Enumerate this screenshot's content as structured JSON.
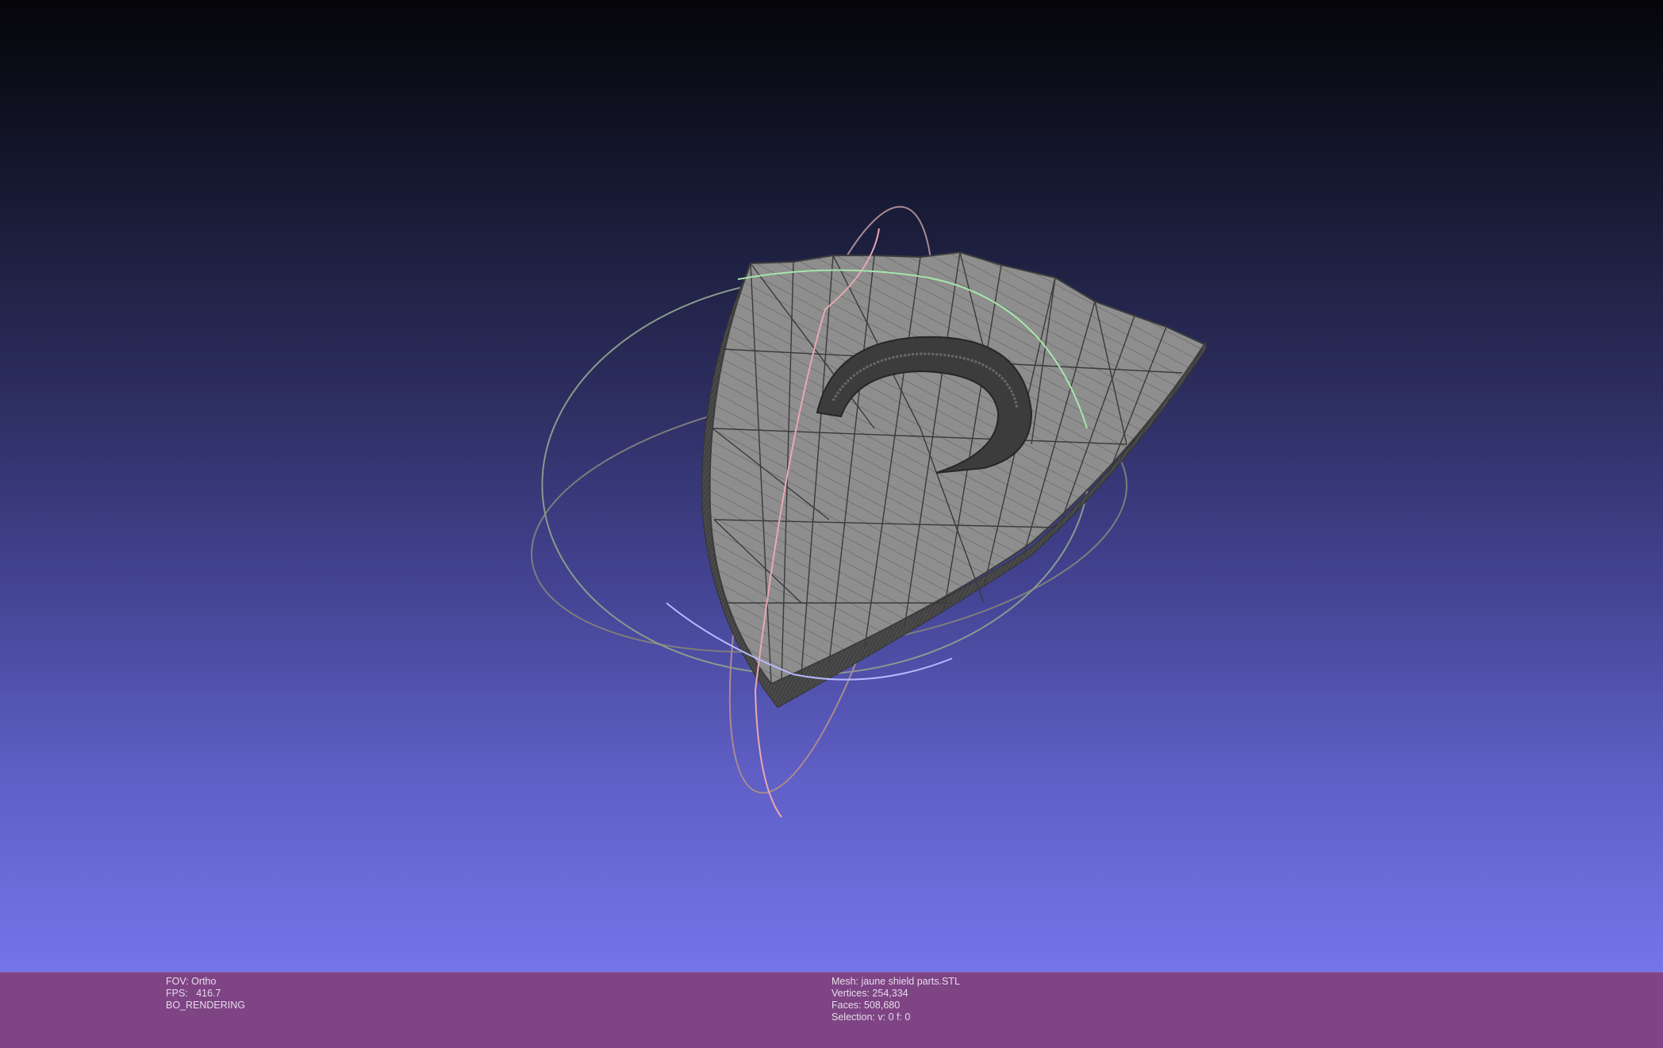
{
  "status_left": {
    "fov": "FOV: Ortho",
    "fps": "FPS:   416.7",
    "mode": "BO_RENDERING"
  },
  "status_right": {
    "mesh": "Mesh: jaune shield parts.STL",
    "vertices": "Vertices: 254,334",
    "faces": "Faces: 508,680",
    "selection": "Selection: v: 0 f: 0"
  },
  "colors": {
    "background_top": "#050509",
    "background_bottom": "#7575ea",
    "status_bar": "#7e4484",
    "mesh_fill": "#8c8c8c",
    "mesh_edge": "#3a3a3a",
    "trackball_red": "#e8a0a8",
    "trackball_green": "#a8e0a8",
    "trackball_blue": "#b0b0ff"
  }
}
